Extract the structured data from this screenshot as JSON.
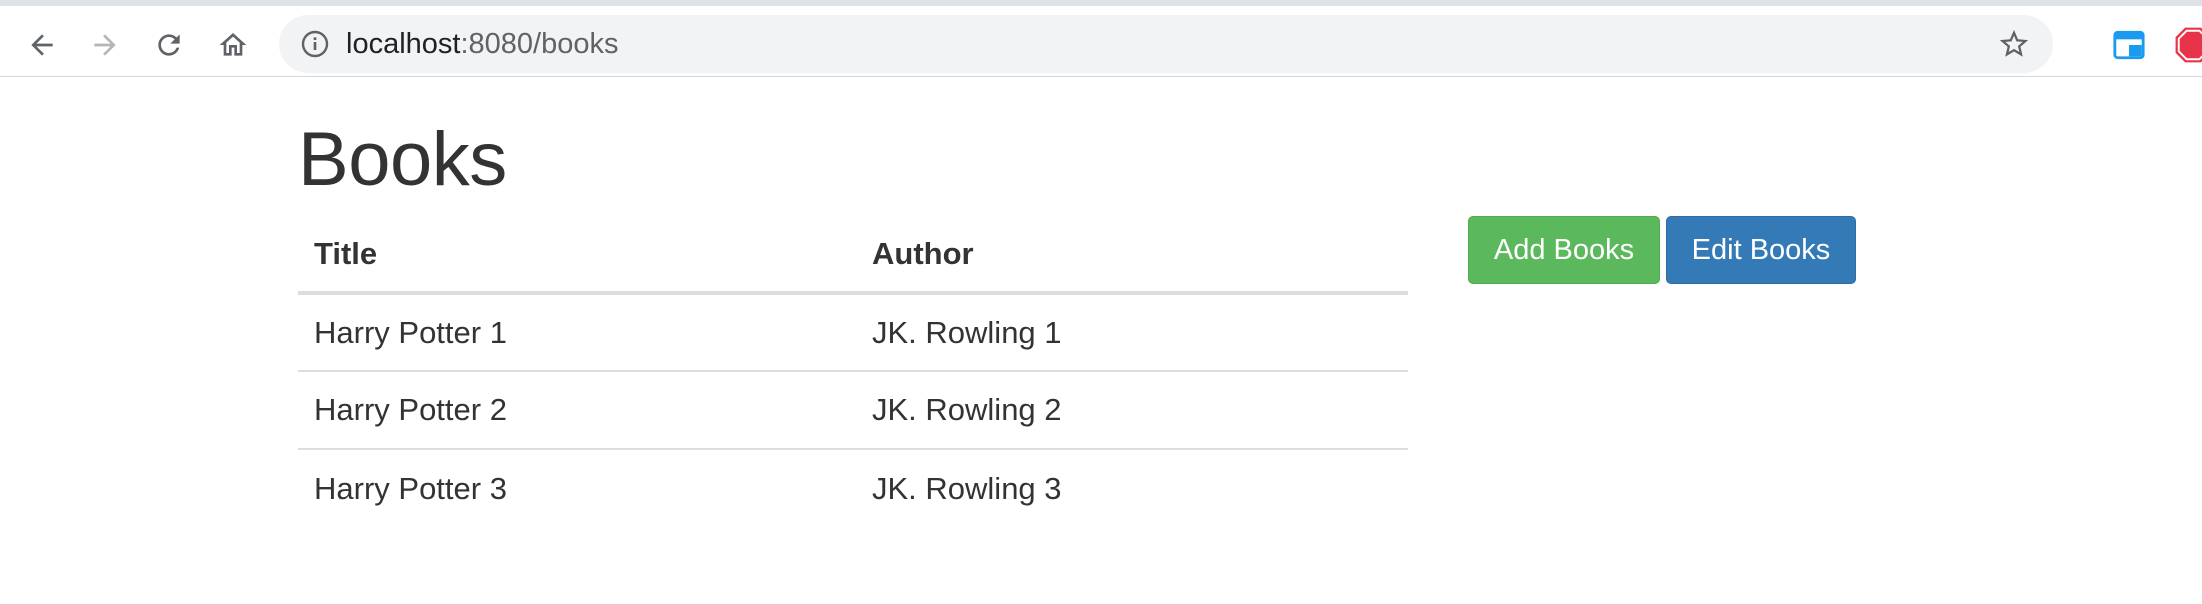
{
  "browser": {
    "url_host": "localhost",
    "url_rest": ":8080/books",
    "icons": {
      "back": "arrow-left-icon",
      "forward": "arrow-right-icon",
      "reload": "reload-icon",
      "home": "home-icon",
      "site_info": "info-icon",
      "bookmark": "star-icon",
      "extension_1": "extension-icon",
      "extension_2": "adblock-icon"
    },
    "colors": {
      "icon": "#5f6368",
      "icon_disabled": "#b4b6b8",
      "omnibox_bg": "#f1f3f4"
    }
  },
  "page": {
    "title": "Books",
    "table": {
      "headers": [
        "Title",
        "Author"
      ],
      "rows": [
        [
          "Harry Potter 1",
          "JK. Rowling 1"
        ],
        [
          "Harry Potter 2",
          "JK. Rowling 2"
        ],
        [
          "Harry Potter 3",
          "JK. Rowling 3"
        ]
      ]
    },
    "buttons": {
      "add_label": "Add Books",
      "edit_label": "Edit Books"
    },
    "colors": {
      "add_button": "#5cb85c",
      "edit_button": "#337ab7",
      "text": "#333333"
    }
  }
}
